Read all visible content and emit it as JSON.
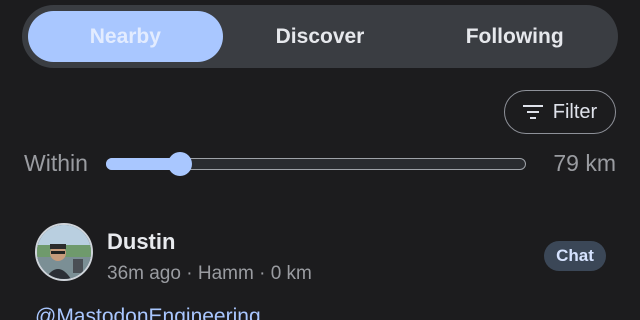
{
  "tabs": [
    {
      "label": "Nearby",
      "active": true
    },
    {
      "label": "Discover",
      "active": false
    },
    {
      "label": "Following",
      "active": false
    }
  ],
  "filter": {
    "label": "Filter",
    "icon": "filter-list-icon"
  },
  "distance": {
    "label": "Within",
    "value_text": "79 km",
    "slider_fraction": 0.175
  },
  "post": {
    "author": "Dustin",
    "time": "36m ago",
    "location": "Hamm",
    "distance": "0 km",
    "chat_label": "Chat",
    "mention": "@MastodonEngineering"
  },
  "colors": {
    "accent": "#a9c7ff",
    "background": "#1c1c1e",
    "tab_bar": "#3a3d42"
  }
}
